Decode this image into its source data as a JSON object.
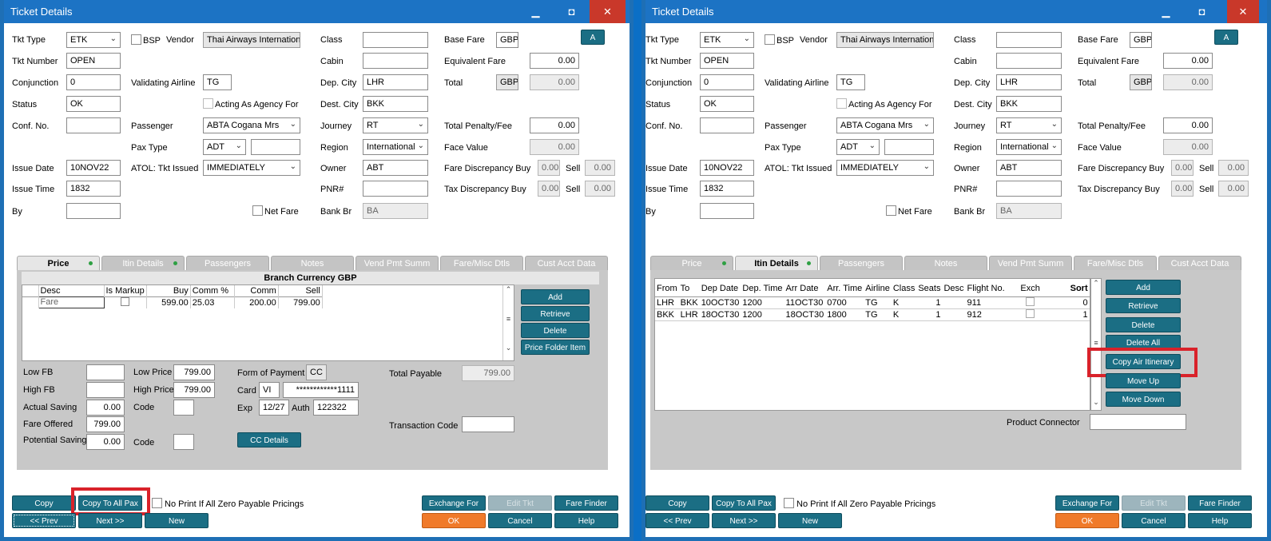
{
  "window": {
    "title": "Ticket Details",
    "minimize": "▁",
    "maximize": "◘",
    "close": "✕"
  },
  "labels": {
    "tkt_type": "Tkt Type",
    "tkt_number": "Tkt Number",
    "conjunction": "Conjunction",
    "status": "Status",
    "conf_no": "Conf. No.",
    "issue_date": "Issue Date",
    "issue_time": "Issue Time",
    "by": "By",
    "bsp": "BSP",
    "vendor": "Vendor",
    "validating_airline": "Validating Airline",
    "acting_as_agency": "Acting As Agency For",
    "passenger": "Passenger",
    "pax_type": "Pax Type",
    "atol": "ATOL: Tkt Issued",
    "net_fare": "Net Fare",
    "class": "Class",
    "cabin": "Cabin",
    "dep_city": "Dep. City",
    "dest_city": "Dest. City",
    "journey": "Journey",
    "region": "Region",
    "owner": "Owner",
    "pnr": "PNR#",
    "bank_br": "Bank Br",
    "base_fare": "Base Fare",
    "equivalent_fare": "Equivalent Fare",
    "total": "Total",
    "total_penalty": "Total Penalty/Fee",
    "face_value": "Face Value",
    "fare_disc_buy": "Fare Discrepancy Buy",
    "tax_disc_buy": "Tax Discrepancy Buy",
    "sell": "Sell"
  },
  "values": {
    "tkt_type": "ETK",
    "tkt_number": "OPEN",
    "conjunction": "0",
    "status": "OK",
    "conf_no": "",
    "issue_date": "10NOV22",
    "issue_time": "1832",
    "by": "",
    "vendor": "Thai Airways Internationa",
    "validating_airline": "TG",
    "passenger": "ABTA Cogana Mrs",
    "pax_type": "ADT",
    "atol": "IMMEDIATELY",
    "class": "",
    "cabin": "",
    "dep_city": "LHR",
    "dest_city": "BKK",
    "journey": "RT",
    "region": "International",
    "owner": "ABT",
    "pnr": "",
    "bank_br": "BA",
    "base_fare_cur": "GBP",
    "equivalent_fare": "0.00",
    "total_cur": "GBP",
    "total": "0.00",
    "total_penalty": "0.00",
    "face_value": "0.00",
    "fare_disc_buy": "0.00",
    "fare_disc_sell": "0.00",
    "tax_disc_buy": "0.00",
    "tax_disc_sell": "0.00",
    "a_button": "A"
  },
  "tabs": [
    "Price",
    "Itin Details",
    "Passengers",
    "Notes",
    "Vend Pmt Summ",
    "Fare/Misc Dtls",
    "Cust Acct Data"
  ],
  "price": {
    "header": "Branch Currency GBP",
    "columns": [
      "Desc",
      "Is Markup",
      "Buy",
      "Comm %",
      "Comm",
      "Sell"
    ],
    "row": {
      "desc": "Fare",
      "buy": "599.00",
      "comm_pct": "25.03",
      "comm": "200.00",
      "sell": "799.00"
    },
    "buttons": [
      "Add",
      "Retrieve",
      "Delete",
      "Price Folder Item"
    ],
    "low_fb": "Low FB",
    "high_fb": "High FB",
    "actual_saving": "Actual Saving",
    "actual_saving_val": "0.00",
    "fare_offered": "Fare Offered",
    "fare_offered_val": "799.00",
    "potential_saving": "Potential Saving",
    "potential_saving_val": "0.00",
    "low_price": "Low Price",
    "low_price_val": "799.00",
    "high_price": "High Price",
    "high_price_val": "799.00",
    "code": "Code",
    "form_of_payment": "Form of Payment",
    "fop_val": "CC",
    "card": "Card",
    "card_type": "VI",
    "card_number": "************1111",
    "exp": "Exp",
    "exp_val": "12/27",
    "auth": "Auth",
    "auth_val": "122322",
    "cc_details": "CC Details",
    "total_payable": "Total Payable",
    "total_payable_val": "799.00",
    "transaction_code": "Transaction Code"
  },
  "itin": {
    "columns": [
      "From",
      "To",
      "Dep Date",
      "Dep. Time",
      "Arr Date",
      "Arr. Time",
      "Airline",
      "Class",
      "Seats",
      "Desc",
      "Flight No.",
      "Exch",
      "Sort"
    ],
    "rows": [
      [
        "LHR",
        "BKK",
        "10OCT30",
        "1200",
        "11OCT30",
        "0700",
        "TG",
        "K",
        "1",
        "",
        "911",
        "",
        "0"
      ],
      [
        "BKK",
        "LHR",
        "18OCT30",
        "1200",
        "18OCT30",
        "1800",
        "TG",
        "K",
        "1",
        "",
        "912",
        "",
        "1"
      ]
    ],
    "buttons": [
      "Add",
      "Retrieve",
      "Delete",
      "Delete All",
      "Copy Air Itinerary",
      "Move Up",
      "Move Down"
    ],
    "product_connector": "Product Connector"
  },
  "footer": {
    "copy": "Copy",
    "copy_to_all": "Copy To All Pax",
    "no_print": "No Print If All Zero Payable Pricings",
    "exchange_for": "Exchange For",
    "edit_tkt": "Edit Tkt",
    "fare_finder": "Fare Finder",
    "prev": "<< Prev",
    "next": "Next >>",
    "new": "New",
    "ok": "OK",
    "cancel": "Cancel",
    "help": "Help"
  },
  "colors": {
    "highlight": "#d9222a",
    "button": "#1b6e84",
    "titlebar": "#1c73c4",
    "ok": "#f07a2a"
  }
}
